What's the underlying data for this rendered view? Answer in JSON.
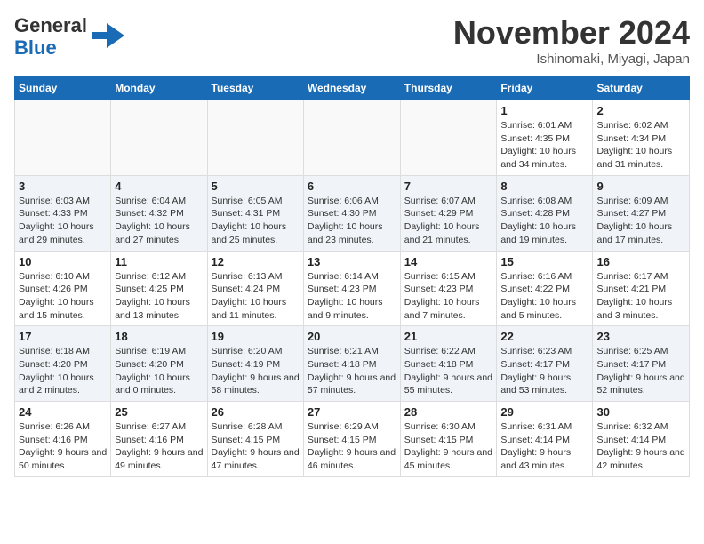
{
  "header": {
    "logo_line1": "General",
    "logo_line2": "Blue",
    "month_title": "November 2024",
    "location": "Ishinomaki, Miyagi, Japan"
  },
  "weekdays": [
    "Sunday",
    "Monday",
    "Tuesday",
    "Wednesday",
    "Thursday",
    "Friday",
    "Saturday"
  ],
  "weeks": [
    [
      {
        "day": "",
        "info": ""
      },
      {
        "day": "",
        "info": ""
      },
      {
        "day": "",
        "info": ""
      },
      {
        "day": "",
        "info": ""
      },
      {
        "day": "",
        "info": ""
      },
      {
        "day": "1",
        "info": "Sunrise: 6:01 AM\nSunset: 4:35 PM\nDaylight: 10 hours and 34 minutes."
      },
      {
        "day": "2",
        "info": "Sunrise: 6:02 AM\nSunset: 4:34 PM\nDaylight: 10 hours and 31 minutes."
      }
    ],
    [
      {
        "day": "3",
        "info": "Sunrise: 6:03 AM\nSunset: 4:33 PM\nDaylight: 10 hours and 29 minutes."
      },
      {
        "day": "4",
        "info": "Sunrise: 6:04 AM\nSunset: 4:32 PM\nDaylight: 10 hours and 27 minutes."
      },
      {
        "day": "5",
        "info": "Sunrise: 6:05 AM\nSunset: 4:31 PM\nDaylight: 10 hours and 25 minutes."
      },
      {
        "day": "6",
        "info": "Sunrise: 6:06 AM\nSunset: 4:30 PM\nDaylight: 10 hours and 23 minutes."
      },
      {
        "day": "7",
        "info": "Sunrise: 6:07 AM\nSunset: 4:29 PM\nDaylight: 10 hours and 21 minutes."
      },
      {
        "day": "8",
        "info": "Sunrise: 6:08 AM\nSunset: 4:28 PM\nDaylight: 10 hours and 19 minutes."
      },
      {
        "day": "9",
        "info": "Sunrise: 6:09 AM\nSunset: 4:27 PM\nDaylight: 10 hours and 17 minutes."
      }
    ],
    [
      {
        "day": "10",
        "info": "Sunrise: 6:10 AM\nSunset: 4:26 PM\nDaylight: 10 hours and 15 minutes."
      },
      {
        "day": "11",
        "info": "Sunrise: 6:12 AM\nSunset: 4:25 PM\nDaylight: 10 hours and 13 minutes."
      },
      {
        "day": "12",
        "info": "Sunrise: 6:13 AM\nSunset: 4:24 PM\nDaylight: 10 hours and 11 minutes."
      },
      {
        "day": "13",
        "info": "Sunrise: 6:14 AM\nSunset: 4:23 PM\nDaylight: 10 hours and 9 minutes."
      },
      {
        "day": "14",
        "info": "Sunrise: 6:15 AM\nSunset: 4:23 PM\nDaylight: 10 hours and 7 minutes."
      },
      {
        "day": "15",
        "info": "Sunrise: 6:16 AM\nSunset: 4:22 PM\nDaylight: 10 hours and 5 minutes."
      },
      {
        "day": "16",
        "info": "Sunrise: 6:17 AM\nSunset: 4:21 PM\nDaylight: 10 hours and 3 minutes."
      }
    ],
    [
      {
        "day": "17",
        "info": "Sunrise: 6:18 AM\nSunset: 4:20 PM\nDaylight: 10 hours and 2 minutes."
      },
      {
        "day": "18",
        "info": "Sunrise: 6:19 AM\nSunset: 4:20 PM\nDaylight: 10 hours and 0 minutes."
      },
      {
        "day": "19",
        "info": "Sunrise: 6:20 AM\nSunset: 4:19 PM\nDaylight: 9 hours and 58 minutes."
      },
      {
        "day": "20",
        "info": "Sunrise: 6:21 AM\nSunset: 4:18 PM\nDaylight: 9 hours and 57 minutes."
      },
      {
        "day": "21",
        "info": "Sunrise: 6:22 AM\nSunset: 4:18 PM\nDaylight: 9 hours and 55 minutes."
      },
      {
        "day": "22",
        "info": "Sunrise: 6:23 AM\nSunset: 4:17 PM\nDaylight: 9 hours and 53 minutes."
      },
      {
        "day": "23",
        "info": "Sunrise: 6:25 AM\nSunset: 4:17 PM\nDaylight: 9 hours and 52 minutes."
      }
    ],
    [
      {
        "day": "24",
        "info": "Sunrise: 6:26 AM\nSunset: 4:16 PM\nDaylight: 9 hours and 50 minutes."
      },
      {
        "day": "25",
        "info": "Sunrise: 6:27 AM\nSunset: 4:16 PM\nDaylight: 9 hours and 49 minutes."
      },
      {
        "day": "26",
        "info": "Sunrise: 6:28 AM\nSunset: 4:15 PM\nDaylight: 9 hours and 47 minutes."
      },
      {
        "day": "27",
        "info": "Sunrise: 6:29 AM\nSunset: 4:15 PM\nDaylight: 9 hours and 46 minutes."
      },
      {
        "day": "28",
        "info": "Sunrise: 6:30 AM\nSunset: 4:15 PM\nDaylight: 9 hours and 45 minutes."
      },
      {
        "day": "29",
        "info": "Sunrise: 6:31 AM\nSunset: 4:14 PM\nDaylight: 9 hours and 43 minutes."
      },
      {
        "day": "30",
        "info": "Sunrise: 6:32 AM\nSunset: 4:14 PM\nDaylight: 9 hours and 42 minutes."
      }
    ]
  ]
}
